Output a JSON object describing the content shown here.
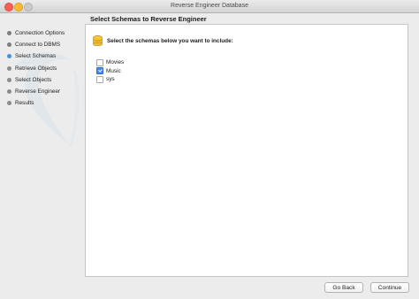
{
  "window": {
    "title": "Reverse Engineer Database"
  },
  "sidebar": {
    "steps": [
      {
        "label": "Connection Options",
        "state": "done"
      },
      {
        "label": "Connect to DBMS",
        "state": "done"
      },
      {
        "label": "Select Schemas",
        "state": "current"
      },
      {
        "label": "Retrieve Objects",
        "state": "pending"
      },
      {
        "label": "Select Objects",
        "state": "pending"
      },
      {
        "label": "Reverse Engineer",
        "state": "pending"
      },
      {
        "label": "Results",
        "state": "pending"
      }
    ]
  },
  "main": {
    "title": "Select Schemas to Reverse Engineer",
    "instruction": "Select the schemas below you want to include:",
    "icon": "database-icon",
    "schemas": [
      {
        "label": "Movies",
        "checked": false
      },
      {
        "label": "Music",
        "checked": true
      },
      {
        "label": "sys",
        "checked": false
      }
    ]
  },
  "footer": {
    "back_label": "Go Back",
    "continue_label": "Continue"
  },
  "colors": {
    "current_step": "#4a90d9",
    "checkbox_checked": "#3d8af7",
    "db_icon": "#f2c230"
  }
}
